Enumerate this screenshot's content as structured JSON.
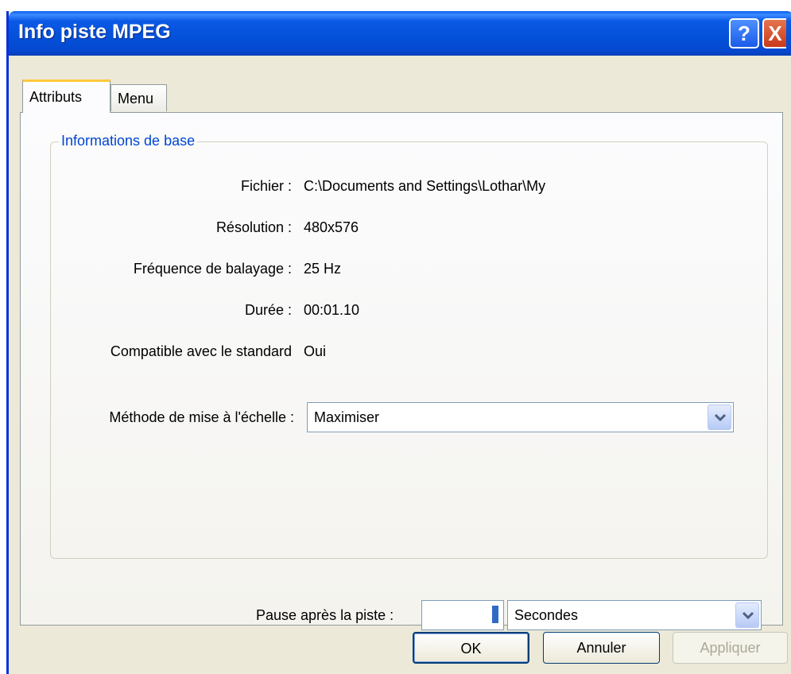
{
  "window": {
    "title": "Info piste MPEG",
    "help_label": "?",
    "close_label": "X"
  },
  "tabs": [
    {
      "label": "Attributs"
    },
    {
      "label": "Menu"
    }
  ],
  "group": {
    "legend": "Informations de base",
    "rows": [
      {
        "label": "Fichier :",
        "value": "C:\\Documents and Settings\\Lothar\\My"
      },
      {
        "label": "Résolution :",
        "value": "480x576"
      },
      {
        "label": "Fréquence de balayage :",
        "value": "25 Hz"
      },
      {
        "label": "Durée :",
        "value": "00:01.10"
      },
      {
        "label": "Compatible avec le standard",
        "value": "Oui"
      }
    ],
    "scale": {
      "label": "Méthode de mise à l'échelle :",
      "value": "Maximiser"
    }
  },
  "pause": {
    "label": "Pause après la piste :",
    "value": "",
    "unit": "Secondes"
  },
  "buttons": {
    "ok": "OK",
    "cancel": "Annuler",
    "apply": "Appliquer"
  }
}
